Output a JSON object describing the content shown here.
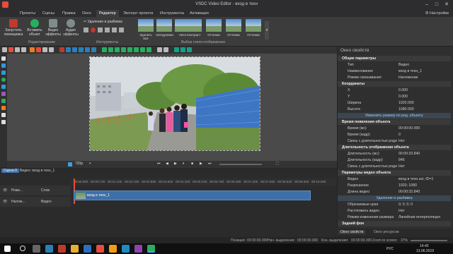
{
  "window": {
    "title": "VSDC Video Editor - вход в техн",
    "controls": [
      "–",
      "□",
      "✕"
    ]
  },
  "menu": {
    "tabs": [
      "Проекты",
      "Сцены",
      "Правка",
      "Окно",
      "Редактор",
      "Экспорт проекта",
      "Инструменты",
      "Активация"
    ],
    "active": "Редактор",
    "settings": "Настройки"
  },
  "ribbon": {
    "buttons": [
      {
        "label": "Запустить помощника",
        "icon": "wizard-icon",
        "color": "#c0392b"
      },
      {
        "label": "Вставить объект",
        "icon": "insert-object-icon",
        "color": "#27ae60"
      },
      {
        "label": "Видео эффекты",
        "icon": "video-effects-icon",
        "color": "#7f8c8d"
      },
      {
        "label": "Аудио эффекты",
        "icon": "audio-effects-icon",
        "color": "#7f8c8d"
      }
    ],
    "group_editing": "Редактирование",
    "cut_split": "Удаление и разбивка",
    "tools_label": "Инструменты",
    "styles": [
      "Удалить все",
      "Автоуровни",
      "Авто",
      "Контраст",
      "Оттенки",
      "Оттенки",
      "Оттенки"
    ],
    "styles_group": "Выбор стиля отображения"
  },
  "player": {
    "zoom": "720p"
  },
  "scene_tabs": {
    "scene": "Сцена 0",
    "video_tab": "Видео: вход в техн_1"
  },
  "timeline": {
    "rows": [
      {
        "mode": "Режи...",
        "label": "Слои"
      },
      {
        "mode": "Налож...",
        "label": "Видео"
      }
    ],
    "ticks": [
      "00:00.000",
      "00:00.720",
      "00:01.440",
      "00:02.160",
      "00:02.880",
      "00:03.600",
      "00:04.320",
      "00:05.040",
      "00:05.760",
      "00:06.480",
      "00:07.200",
      "00:07.920",
      "00:08.640",
      "00:09.360",
      "00:10.080"
    ],
    "clip_label": "вход в техн_1"
  },
  "props": {
    "header": "Окно свойств",
    "rows": [
      {
        "type": "sec",
        "k": "Общие параметры",
        "v": ""
      },
      {
        "type": "row",
        "k": "Тип",
        "v": "Видео"
      },
      {
        "type": "row",
        "k": "Наименование",
        "v": "вход в техн_1"
      },
      {
        "type": "row",
        "k": "Режим смешивания",
        "v": "Наложение"
      },
      {
        "type": "sec",
        "k": "Координаты",
        "v": ""
      },
      {
        "type": "row",
        "k": "X",
        "v": "0.000"
      },
      {
        "type": "row",
        "k": "Y",
        "v": "0.000"
      },
      {
        "type": "row",
        "k": "Ширина",
        "v": "1920.000"
      },
      {
        "type": "row",
        "k": "Высота",
        "v": "1080.000"
      },
      {
        "type": "btn",
        "k": "Изменить размер по род. объекту",
        "v": ""
      },
      {
        "type": "sec",
        "k": "Время появления объекта",
        "v": ""
      },
      {
        "type": "row",
        "k": "Время (мс)",
        "v": "00:00:00.000"
      },
      {
        "type": "row",
        "k": "Время (кадр)",
        "v": "0"
      },
      {
        "type": "row",
        "k": "Связь с длительностью роди",
        "v": "Нет"
      },
      {
        "type": "sec",
        "k": "Длительность отображения объекта",
        "v": ""
      },
      {
        "type": "row",
        "k": "Длительность (мс)",
        "v": "00:00:33.840"
      },
      {
        "type": "row",
        "k": "Длительность (кадр)",
        "v": "846"
      },
      {
        "type": "row",
        "k": "Связь с длительностью роди",
        "v": "Нет"
      },
      {
        "type": "sec",
        "k": "Параметры видео объекта",
        "v": ""
      },
      {
        "type": "row",
        "k": "Видео",
        "v": "вход в техн.avi; ID=1"
      },
      {
        "type": "row",
        "k": "Разрешение",
        "v": "1920; 1080"
      },
      {
        "type": "row",
        "k": "Длина видео",
        "v": "00:00:33.840"
      },
      {
        "type": "btn",
        "k": "Удаление и разбивка",
        "v": ""
      },
      {
        "type": "row",
        "k": "Обрезаемые края",
        "v": "0; 0; 0; 0"
      },
      {
        "type": "row",
        "k": "Растягивать видео",
        "v": "Нет"
      },
      {
        "type": "row",
        "k": "Режим изменения размера",
        "v": "Линейная интерполяция"
      },
      {
        "type": "sec",
        "k": "Задний фон",
        "v": ""
      }
    ],
    "tabs": [
      "Окно свойств",
      "Окно ресурсов"
    ]
  },
  "status": {
    "position_label": "Позиция:",
    "position": "00:00:00.000",
    "start_label": "Нач. выделения:",
    "start": "00:00:00.000",
    "end_label": "Кон. выделения:",
    "end": "00:00:00.000",
    "zoom_label": "Zoom to screen",
    "zoom": "37%"
  },
  "taskbar": {
    "lang": "РУС",
    "time": "14:40",
    "date": "13.06.2019"
  }
}
